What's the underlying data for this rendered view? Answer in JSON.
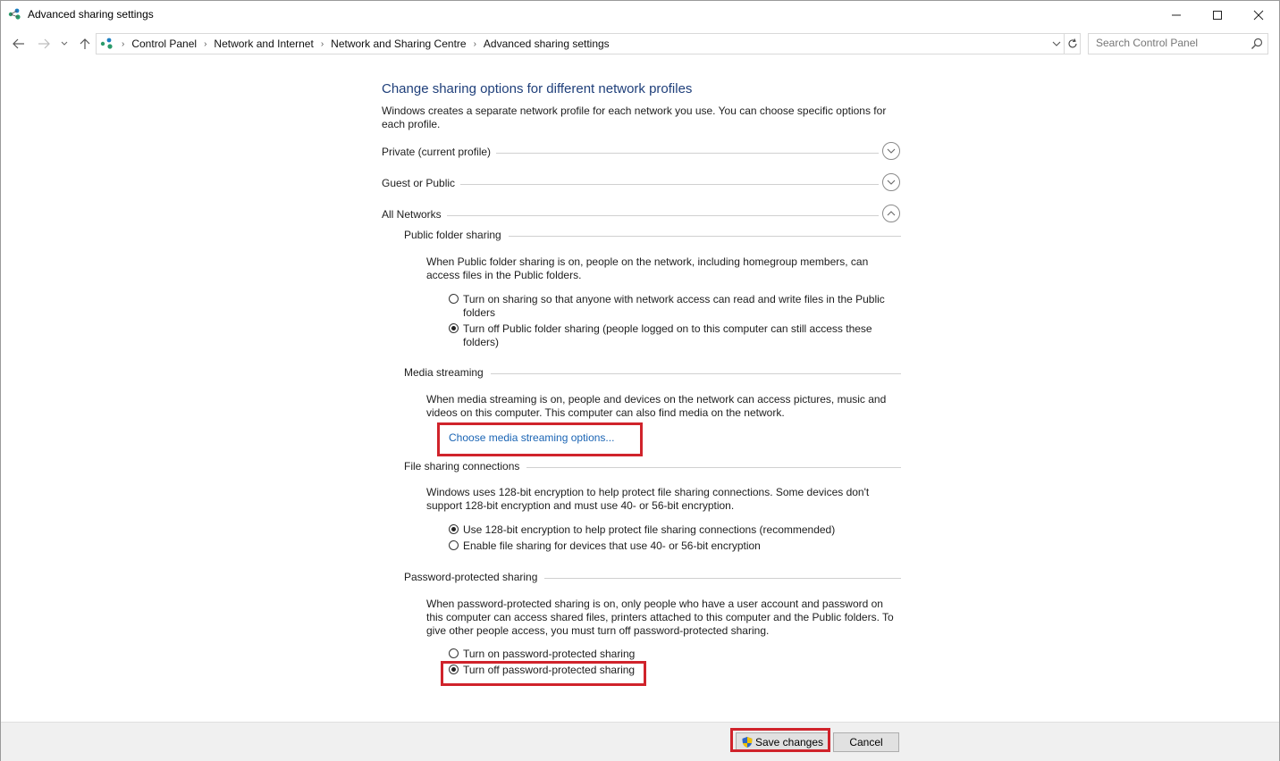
{
  "window": {
    "title": "Advanced sharing settings",
    "minimize_icon": "minimize-icon",
    "maximize_icon": "maximize-icon",
    "close_icon": "close-icon"
  },
  "nav": {
    "back_icon": "arrow-left-icon",
    "forward_icon": "arrow-right-icon",
    "recent_icon": "chevron-down-icon",
    "up_icon": "arrow-up-icon",
    "breadcrumbs": [
      "Control Panel",
      "Network and Internet",
      "Network and Sharing Centre",
      "Advanced sharing settings"
    ],
    "refresh_icon": "refresh-icon",
    "search_placeholder": "Search Control Panel"
  },
  "content": {
    "heading": "Change sharing options for different network profiles",
    "description": "Windows creates a separate network profile for each network you use. You can choose specific options for each profile.",
    "profiles": [
      {
        "label": "Private (current profile)",
        "expanded": false
      },
      {
        "label": "Guest or Public",
        "expanded": false
      },
      {
        "label": "All Networks",
        "expanded": true
      }
    ],
    "public_folder": {
      "title": "Public folder sharing",
      "text": "When Public folder sharing is on, people on the network, including homegroup members, can access files in the Public folders.",
      "option_on": "Turn on sharing so that anyone with network access can read and write files in the Public folders",
      "option_off": "Turn off Public folder sharing (people logged on to this computer can still access these folders)",
      "selected": "off"
    },
    "media": {
      "title": "Media streaming",
      "text": "When media streaming is on, people and devices on the network can access pictures, music and videos on this computer. This computer can also find media on the network.",
      "link": "Choose media streaming options..."
    },
    "file_sharing": {
      "title": "File sharing connections",
      "text": "Windows uses 128-bit encryption to help protect file sharing connections. Some devices don't support 128-bit encryption and must use 40- or 56-bit encryption.",
      "option_128": "Use 128-bit encryption to help protect file sharing connections (recommended)",
      "option_40": "Enable file sharing for devices that use 40- or 56-bit encryption",
      "selected": "128"
    },
    "password": {
      "title": "Password-protected sharing",
      "text": "When password-protected sharing is on, only people who have a user account and password on this computer can access shared files, printers attached to this computer and the Public folders. To give other people access, you must turn off password-protected sharing.",
      "option_on": "Turn on password-protected sharing",
      "option_off": "Turn off password-protected sharing",
      "selected": "off"
    }
  },
  "footer": {
    "save_label": "Save changes",
    "cancel_label": "Cancel",
    "shield_icon": "uac-shield-icon"
  },
  "colors": {
    "heading": "#1f3f7a",
    "link": "#1a64b4",
    "highlight": "#d0232b"
  }
}
